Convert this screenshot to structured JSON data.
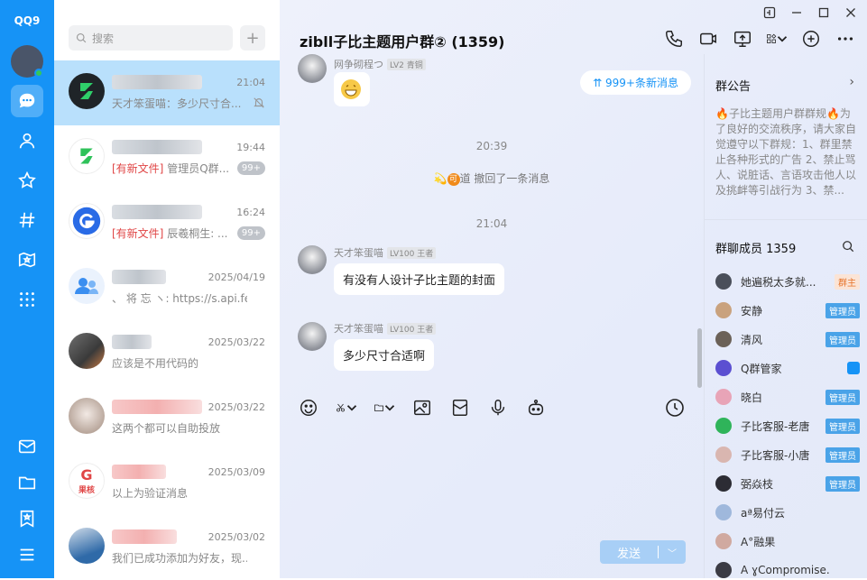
{
  "app": {
    "logo": "QQ9"
  },
  "search": {
    "placeholder": "搜索"
  },
  "conversations": [
    {
      "time": "21:04",
      "preview": "天才笨蛋喵：多少尺寸合...",
      "tag": "",
      "badge": "",
      "muted": true,
      "active": true
    },
    {
      "time": "19:44",
      "tag": "[有新文件]",
      "preview": " 管理员Q群...",
      "badge": "99+"
    },
    {
      "time": "16:24",
      "tag": "[有新文件]",
      "preview": " 辰羲桐生: ...",
      "badge": "99+"
    },
    {
      "time": "2025/04/19",
      "preview": "、 将 忘 ヽ: https://s.api.fe...",
      "tag": "",
      "badge": ""
    },
    {
      "time": "2025/03/22",
      "preview": "应该是不用代码的",
      "tag": "",
      "badge": ""
    },
    {
      "time": "2025/03/22",
      "preview": "这两个都可以自助投放",
      "tag": "",
      "badge": ""
    },
    {
      "time": "2025/03/09",
      "preview": "以上为验证消息",
      "tag": "",
      "badge": "",
      "avatar_text": "果核"
    },
    {
      "time": "2025/03/02",
      "preview": "我们已成功添加为好友，现...",
      "tag": "",
      "badge": ""
    }
  ],
  "chat": {
    "title": "zibll子比主题用户群② (1359)",
    "new_messages": "999+条新消息",
    "top_sender": "网争砌程つ",
    "top_level": "LV2 青铜",
    "time1": "20:39",
    "recall_notice": "道 撤回了一条消息",
    "time2": "21:04",
    "messages": [
      {
        "sender": "天才笨蛋喵",
        "level": "LV100 王者",
        "text": "有没有人设计子比主题的封面"
      },
      {
        "sender": "天才笨蛋喵",
        "level": "LV100 王者",
        "text": "多少尺寸合适啊"
      }
    ],
    "send_label": "发送"
  },
  "sidebar": {
    "announcement_title": "群公告",
    "announcement_text": "🔥子比主题用户群群规🔥为了良好的交流秩序，请大家自觉遵守以下群规：1、群里禁止各种形式的广告 2、禁止骂人、说脏话、言语攻击他人以及挑衅等引战行为 3、禁...",
    "members_title": "群聊成员 1359",
    "members": [
      {
        "name": "她遍税太多就...",
        "role": "群主",
        "color": "#4a4f5a"
      },
      {
        "name": "安静",
        "role": "管理员",
        "color": "#c9a27e"
      },
      {
        "name": "清风",
        "role": "管理员",
        "color": "#6b6158"
      },
      {
        "name": "Q群管家",
        "role": "",
        "color": "#5b4fd1"
      },
      {
        "name": "晓白",
        "role": "管理员",
        "color": "#e8a4b7"
      },
      {
        "name": "子比客服-老唐",
        "role": "管理员",
        "color": "#2fb45a"
      },
      {
        "name": "子比客服-小唐",
        "role": "管理员",
        "color": "#d9b6b0"
      },
      {
        "name": "弼焱枝",
        "role": "管理员",
        "color": "#2c2c34"
      },
      {
        "name": "aª易付云",
        "role": "",
        "color": "#9fb8dc"
      },
      {
        "name": "A°融果",
        "role": "",
        "color": "#d0a9a0"
      },
      {
        "name": "A ɣCompromise.",
        "role": "",
        "color": "#3b3b44"
      }
    ]
  }
}
